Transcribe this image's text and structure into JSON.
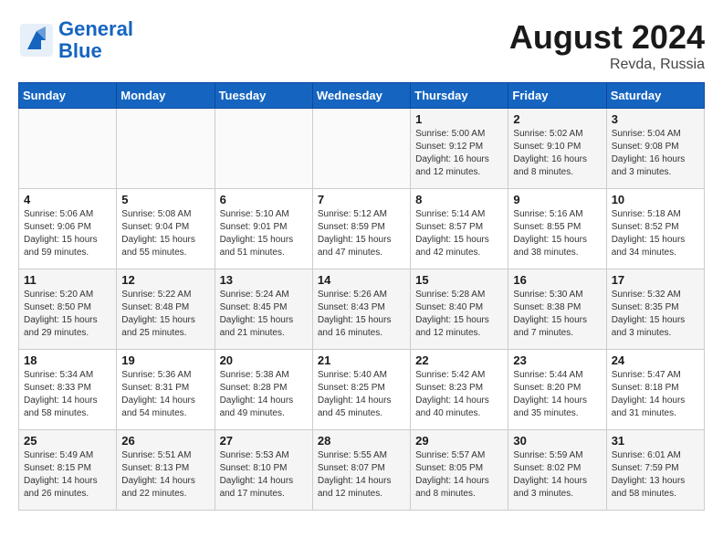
{
  "header": {
    "logo_line1": "General",
    "logo_line2": "Blue",
    "month_year": "August 2024",
    "location": "Revda, Russia"
  },
  "days_of_week": [
    "Sunday",
    "Monday",
    "Tuesday",
    "Wednesday",
    "Thursday",
    "Friday",
    "Saturday"
  ],
  "weeks": [
    [
      {
        "day": "",
        "info": ""
      },
      {
        "day": "",
        "info": ""
      },
      {
        "day": "",
        "info": ""
      },
      {
        "day": "",
        "info": ""
      },
      {
        "day": "1",
        "info": "Sunrise: 5:00 AM\nSunset: 9:12 PM\nDaylight: 16 hours\nand 12 minutes."
      },
      {
        "day": "2",
        "info": "Sunrise: 5:02 AM\nSunset: 9:10 PM\nDaylight: 16 hours\nand 8 minutes."
      },
      {
        "day": "3",
        "info": "Sunrise: 5:04 AM\nSunset: 9:08 PM\nDaylight: 16 hours\nand 3 minutes."
      }
    ],
    [
      {
        "day": "4",
        "info": "Sunrise: 5:06 AM\nSunset: 9:06 PM\nDaylight: 15 hours\nand 59 minutes."
      },
      {
        "day": "5",
        "info": "Sunrise: 5:08 AM\nSunset: 9:04 PM\nDaylight: 15 hours\nand 55 minutes."
      },
      {
        "day": "6",
        "info": "Sunrise: 5:10 AM\nSunset: 9:01 PM\nDaylight: 15 hours\nand 51 minutes."
      },
      {
        "day": "7",
        "info": "Sunrise: 5:12 AM\nSunset: 8:59 PM\nDaylight: 15 hours\nand 47 minutes."
      },
      {
        "day": "8",
        "info": "Sunrise: 5:14 AM\nSunset: 8:57 PM\nDaylight: 15 hours\nand 42 minutes."
      },
      {
        "day": "9",
        "info": "Sunrise: 5:16 AM\nSunset: 8:55 PM\nDaylight: 15 hours\nand 38 minutes."
      },
      {
        "day": "10",
        "info": "Sunrise: 5:18 AM\nSunset: 8:52 PM\nDaylight: 15 hours\nand 34 minutes."
      }
    ],
    [
      {
        "day": "11",
        "info": "Sunrise: 5:20 AM\nSunset: 8:50 PM\nDaylight: 15 hours\nand 29 minutes."
      },
      {
        "day": "12",
        "info": "Sunrise: 5:22 AM\nSunset: 8:48 PM\nDaylight: 15 hours\nand 25 minutes."
      },
      {
        "day": "13",
        "info": "Sunrise: 5:24 AM\nSunset: 8:45 PM\nDaylight: 15 hours\nand 21 minutes."
      },
      {
        "day": "14",
        "info": "Sunrise: 5:26 AM\nSunset: 8:43 PM\nDaylight: 15 hours\nand 16 minutes."
      },
      {
        "day": "15",
        "info": "Sunrise: 5:28 AM\nSunset: 8:40 PM\nDaylight: 15 hours\nand 12 minutes."
      },
      {
        "day": "16",
        "info": "Sunrise: 5:30 AM\nSunset: 8:38 PM\nDaylight: 15 hours\nand 7 minutes."
      },
      {
        "day": "17",
        "info": "Sunrise: 5:32 AM\nSunset: 8:35 PM\nDaylight: 15 hours\nand 3 minutes."
      }
    ],
    [
      {
        "day": "18",
        "info": "Sunrise: 5:34 AM\nSunset: 8:33 PM\nDaylight: 14 hours\nand 58 minutes."
      },
      {
        "day": "19",
        "info": "Sunrise: 5:36 AM\nSunset: 8:31 PM\nDaylight: 14 hours\nand 54 minutes."
      },
      {
        "day": "20",
        "info": "Sunrise: 5:38 AM\nSunset: 8:28 PM\nDaylight: 14 hours\nand 49 minutes."
      },
      {
        "day": "21",
        "info": "Sunrise: 5:40 AM\nSunset: 8:25 PM\nDaylight: 14 hours\nand 45 minutes."
      },
      {
        "day": "22",
        "info": "Sunrise: 5:42 AM\nSunset: 8:23 PM\nDaylight: 14 hours\nand 40 minutes."
      },
      {
        "day": "23",
        "info": "Sunrise: 5:44 AM\nSunset: 8:20 PM\nDaylight: 14 hours\nand 35 minutes."
      },
      {
        "day": "24",
        "info": "Sunrise: 5:47 AM\nSunset: 8:18 PM\nDaylight: 14 hours\nand 31 minutes."
      }
    ],
    [
      {
        "day": "25",
        "info": "Sunrise: 5:49 AM\nSunset: 8:15 PM\nDaylight: 14 hours\nand 26 minutes."
      },
      {
        "day": "26",
        "info": "Sunrise: 5:51 AM\nSunset: 8:13 PM\nDaylight: 14 hours\nand 22 minutes."
      },
      {
        "day": "27",
        "info": "Sunrise: 5:53 AM\nSunset: 8:10 PM\nDaylight: 14 hours\nand 17 minutes."
      },
      {
        "day": "28",
        "info": "Sunrise: 5:55 AM\nSunset: 8:07 PM\nDaylight: 14 hours\nand 12 minutes."
      },
      {
        "day": "29",
        "info": "Sunrise: 5:57 AM\nSunset: 8:05 PM\nDaylight: 14 hours\nand 8 minutes."
      },
      {
        "day": "30",
        "info": "Sunrise: 5:59 AM\nSunset: 8:02 PM\nDaylight: 14 hours\nand 3 minutes."
      },
      {
        "day": "31",
        "info": "Sunrise: 6:01 AM\nSunset: 7:59 PM\nDaylight: 13 hours\nand 58 minutes."
      }
    ]
  ]
}
